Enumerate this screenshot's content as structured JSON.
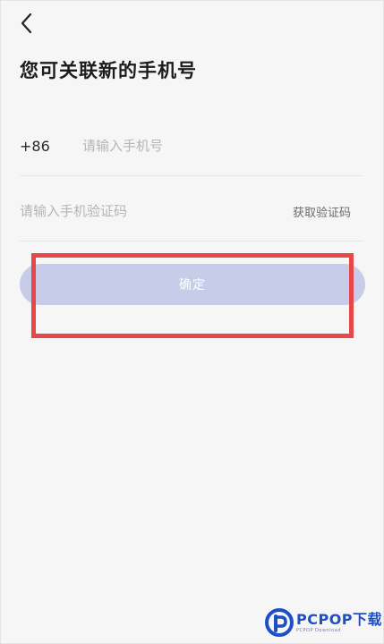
{
  "header": {
    "back_icon": "chevron-left-icon"
  },
  "page": {
    "title": "您可关联新的手机号"
  },
  "phone": {
    "country_code": "+86",
    "placeholder": "请输入手机号",
    "value": ""
  },
  "code": {
    "placeholder": "请输入手机验证码",
    "value": "",
    "get_code_label": "获取验证码"
  },
  "confirm": {
    "label": "确定"
  },
  "colors": {
    "background": "#f6f6f6",
    "button": "#c7cce9",
    "highlight": "#e8474a",
    "watermark": "#1f4fc4"
  },
  "watermark": {
    "main": "PCPOP下载",
    "sub": "PCPOP Download"
  }
}
